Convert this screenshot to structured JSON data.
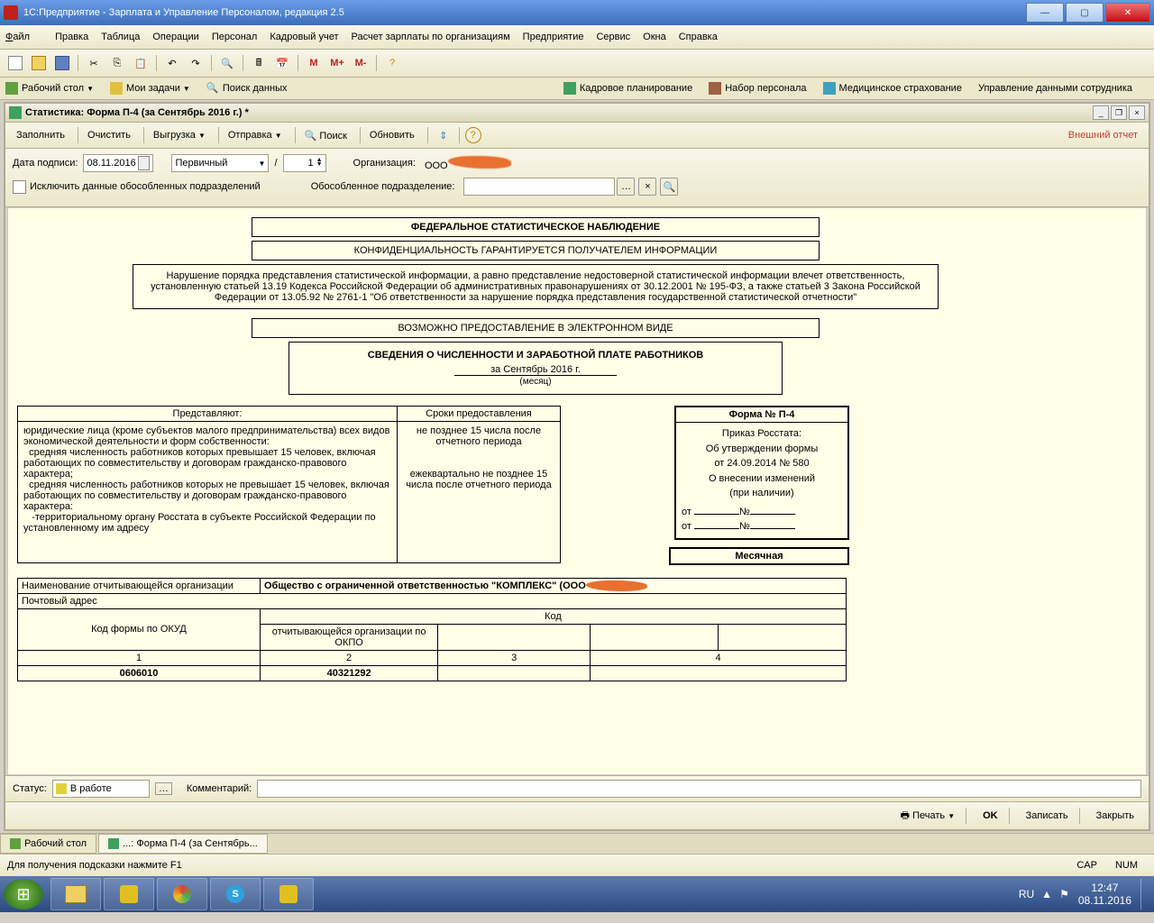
{
  "window": {
    "title": "1С:Предприятие - Зарплата и Управление Персоналом, редакция 2.5"
  },
  "menu": {
    "file": "Файл",
    "edit": "Правка",
    "table": "Таблица",
    "ops": "Операции",
    "pers": "Персонал",
    "hr": "Кадровый учет",
    "calc": "Расчет зарплаты по организациям",
    "ent": "Предприятие",
    "srv": "Сервис",
    "win": "Окна",
    "help": "Справка"
  },
  "nav": {
    "desktop": "Рабочий стол",
    "tasks": "Мои задачи",
    "search": "Поиск данных",
    "plan": "Кадровое планирование",
    "recruit": "Набор персонала",
    "med": "Медицинское страхование",
    "mgmt": "Управление данными сотрудника"
  },
  "subtitle": "Статистика: Форма П-4 (за Сентябрь 2016 г.) *",
  "doctb": {
    "fill": "Заполнить",
    "clear": "Очистить",
    "export": "Выгрузка",
    "send": "Отправка",
    "find": "Поиск",
    "refresh": "Обновить",
    "ext": "Внешний отчет"
  },
  "params": {
    "date_lbl": "Дата подписи:",
    "date": "08.11.2016",
    "type": "Первичный",
    "num": "1",
    "org_lbl": "Организация:",
    "org_prefix": "ООО",
    "excl": "Исключить данные обособленных подразделений",
    "subdiv": "Обособленное подразделение:"
  },
  "doc": {
    "h1": "ФЕДЕРАЛЬНОЕ СТАТИСТИЧЕСКОЕ НАБЛЮДЕНИЕ",
    "h2": "КОНФИДЕНЦИАЛЬНОСТЬ ГАРАНТИРУЕТСЯ ПОЛУЧАТЕЛЕМ ИНФОРМАЦИИ",
    "legal": "Нарушение порядка представления статистической информации, а равно представление недостоверной статистической информации влечет ответственность, установленную статьей 13.19 Кодекса Российской Федерации об административных правонарушениях от 30.12.2001 № 195-ФЗ, а также статьей 3 Закона Российской Федерации от 13.05.92 № 2761-1 \"Об ответственности за нарушение порядка представления государственной статистической отчетности\"",
    "h3": "ВОЗМОЖНО ПРЕДОСТАВЛЕНИЕ В ЭЛЕКТРОННОМ ВИДЕ",
    "title": "СВЕДЕНИЯ О ЧИСЛЕННОСТИ И ЗАРАБОТНОЙ ПЛАТЕ РАБОТНИКОВ",
    "period": "за Сентябрь 2016 г.",
    "period_note": "(месяц)",
    "col1h": "Представляют:",
    "col2h": "Сроки предоставления",
    "col1": "юридические лица (кроме субъектов малого предпринимательства) всех видов экономической деятельности и форм собственности:\n  средняя численность работников которых превышает 15 человек, включая работающих по совместительству и договорам гражданско-правового характера;\n  средняя численность работников которых не превышает 15 человек, включая работающих по совместительству и договорам гражданско-правового характера:\n   -территориальному органу Росстата в субъекте Российской Федерации по установленному им адресу",
    "col2a": "не позднее 15 числа после отчетного периода",
    "col2b": "ежеквартально не позднее 15 числа после отчетного периода",
    "formno": "Форма № П-4",
    "order": "Приказ Росстата:\nОб утверждении формы\nот 24.09.2014 № 580\nО внесении изменений\n(при наличии)",
    "ot": "от",
    "no": "№",
    "monthly": "Месячная",
    "org_name_lbl": "Наименование отчитывающейся организации",
    "org_name": "Общество с ограниченной ответственностью \"КОМПЛЕКС\" (ООО",
    "addr_lbl": "Почтовый адрес",
    "code": "Код",
    "okud_lbl": "Код формы по ОКУД",
    "okpo_lbl": "отчитывающейся организации по ОКПО",
    "n1": "1",
    "n2": "2",
    "n3": "3",
    "n4": "4",
    "okud": "0606010",
    "okpo": "40321292"
  },
  "status": {
    "lbl": "Статус:",
    "val": "В работе",
    "comment": "Комментарий:"
  },
  "bottom": {
    "print": "Печать",
    "ok": "OK",
    "save": "Записать",
    "close": "Закрыть"
  },
  "tabs": {
    "t1": "Рабочий стол",
    "t2": "...: Форма П-4 (за Сентябрь..."
  },
  "hint": "Для получения подсказки нажмите F1",
  "ind": {
    "cap": "CAP",
    "num": "NUM",
    "lang": "RU"
  },
  "clock": {
    "time": "12:47",
    "date": "08.11.2016"
  }
}
